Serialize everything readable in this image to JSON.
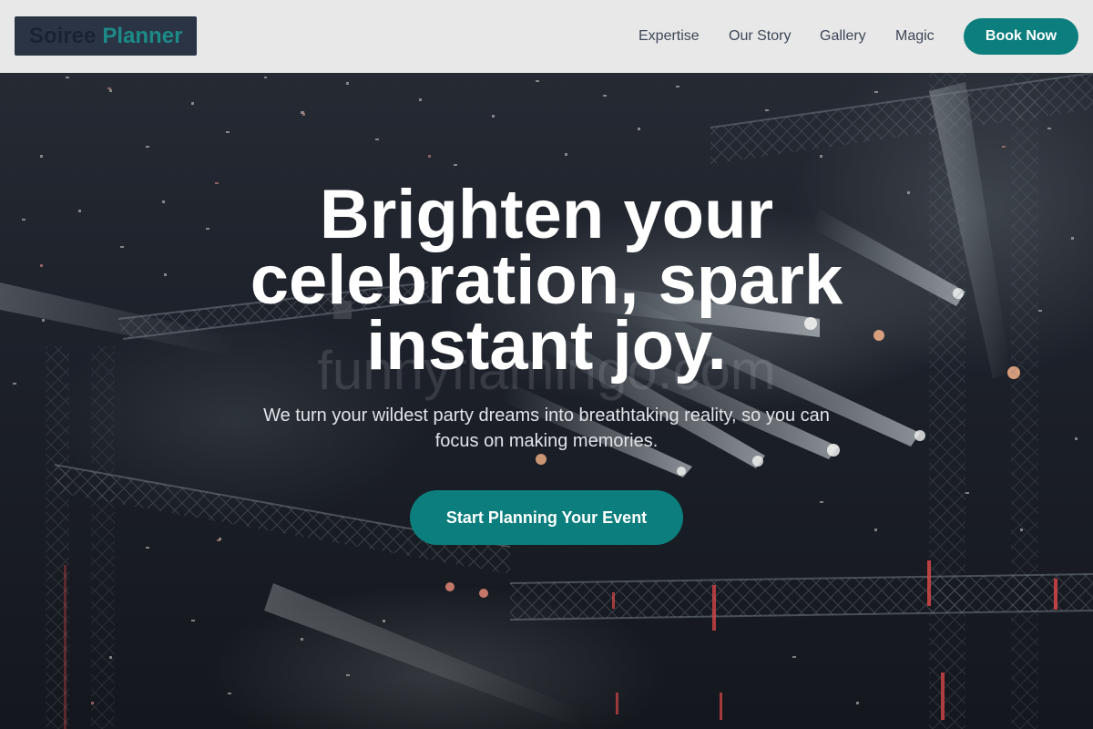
{
  "nav": {
    "logo_word1": "Soiree",
    "logo_word2": "Planner",
    "links": [
      "Expertise",
      "Our Story",
      "Gallery",
      "Magic"
    ],
    "book_label": "Book Now"
  },
  "hero": {
    "headline": "Brighten your celebration, spark instant joy.",
    "subtitle": "We turn your wildest party dreams into breathtaking reality, so you can focus on making memories.",
    "cta_label": "Start Planning Your Event",
    "watermark": "funnyflamingo.com"
  },
  "colors": {
    "accent": "#0c7e7d",
    "navbar_bg": "#e8e8e8",
    "logo_bg": "#2b3445",
    "logo_accent": "#1c8a86",
    "hero_bg": "#1c2029"
  }
}
